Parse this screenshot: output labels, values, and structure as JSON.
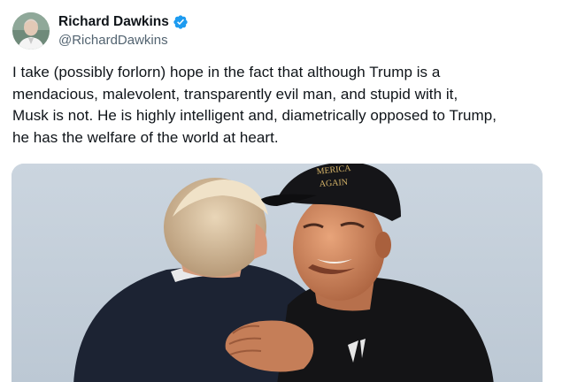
{
  "author": {
    "display_name": "Richard Dawkins",
    "handle": "@RichardDawkins",
    "verified": true,
    "verified_color": "#1d9bf0"
  },
  "tweet": {
    "text": "I take  (possibly forlorn) hope in the fact that although Trump is a\nmendacious, malevolent,  transparently evil man, and stupid with it,\nMusk is not. He is highly intelligent and, diametrically opposed to Trump,\nhe has the welfare of the world at heart."
  },
  "media": {
    "cap_text_line1": "MERICA",
    "cap_text_line2": "AGAIN"
  },
  "icons": {
    "avatar": "avatar-photo",
    "verified": "verified-badge-icon"
  }
}
